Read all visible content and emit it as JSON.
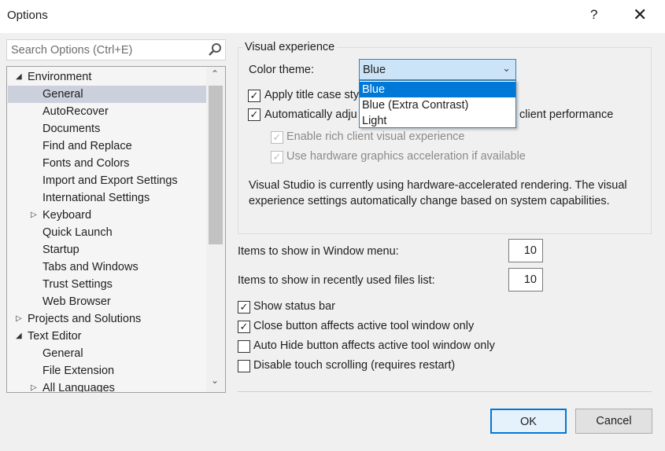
{
  "window": {
    "title": "Options",
    "help_label": "?",
    "close_label": "✕"
  },
  "search": {
    "placeholder": "Search Options (Ctrl+E)"
  },
  "tree": [
    {
      "label": "Environment",
      "level": 0,
      "expander": "expanded"
    },
    {
      "label": "General",
      "level": 1,
      "selected": true
    },
    {
      "label": "AutoRecover",
      "level": 1
    },
    {
      "label": "Documents",
      "level": 1
    },
    {
      "label": "Find and Replace",
      "level": 1
    },
    {
      "label": "Fonts and Colors",
      "level": 1
    },
    {
      "label": "Import and Export Settings",
      "level": 1
    },
    {
      "label": "International Settings",
      "level": 1
    },
    {
      "label": "Keyboard",
      "level": 1,
      "expander": "collapsed"
    },
    {
      "label": "Quick Launch",
      "level": 1
    },
    {
      "label": "Startup",
      "level": 1
    },
    {
      "label": "Tabs and Windows",
      "level": 1
    },
    {
      "label": "Trust Settings",
      "level": 1
    },
    {
      "label": "Web Browser",
      "level": 1
    },
    {
      "label": "Projects and Solutions",
      "level": 0,
      "expander": "collapsed"
    },
    {
      "label": "Text Editor",
      "level": 0,
      "expander": "expanded"
    },
    {
      "label": "General",
      "level": 1
    },
    {
      "label": "File Extension",
      "level": 1
    },
    {
      "label": "All Languages",
      "level": 1,
      "expander": "collapsed"
    }
  ],
  "visual": {
    "group_label": "Visual experience",
    "color_theme_label": "Color theme:",
    "color_theme_value": "Blue",
    "options": [
      "Blue",
      "Blue (Extra Contrast)",
      "Light"
    ],
    "apply_title_case": "Apply title case sty",
    "auto_adjust_a": "Automatically adju",
    "auto_adjust_b": "client performance",
    "rich_client": "Enable rich client visual experience",
    "hw_accel": "Use hardware graphics acceleration if available",
    "info": "Visual Studio is currently using hardware-accelerated rendering. The visual experience settings automatically change based on system capabilities."
  },
  "window_menu": {
    "label": "Items to show in Window menu:",
    "value": "10"
  },
  "recent_files": {
    "label": "Items to show in recently used files list:",
    "value": "10"
  },
  "checks": [
    {
      "label": "Show status bar",
      "checked": true
    },
    {
      "label": "Close button affects active tool window only",
      "checked": true
    },
    {
      "label": "Auto Hide button affects active tool window only",
      "checked": false
    },
    {
      "label": "Disable touch scrolling (requires restart)",
      "checked": false
    }
  ],
  "buttons": {
    "ok": "OK",
    "cancel": "Cancel"
  }
}
